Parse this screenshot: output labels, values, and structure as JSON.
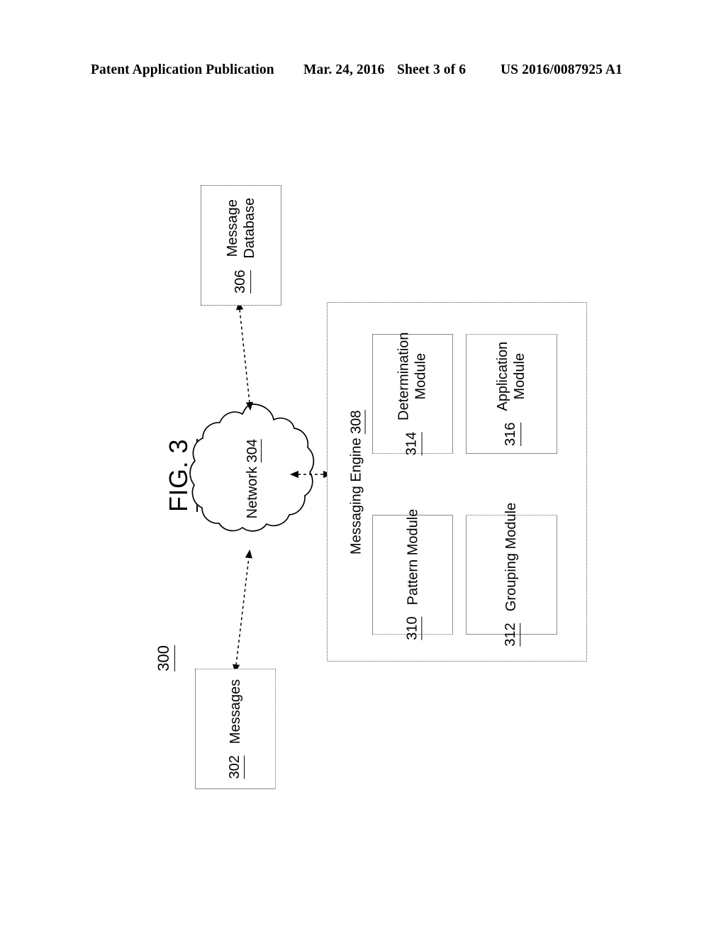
{
  "header": {
    "publication": "Patent Application Publication",
    "date": "Mar. 24, 2016",
    "sheet": "Sheet 3 of 6",
    "patent_number": "US 2016/0087925 A1"
  },
  "figure": {
    "title": "FIG. 3",
    "reference_numeral": "300"
  },
  "nodes": {
    "message_database": {
      "label_line1": "Message",
      "label_line2": "Database",
      "ref": "306"
    },
    "messages": {
      "label_line1": "Messages",
      "label_line2": "",
      "ref": "302"
    },
    "network": {
      "label_line1": "Network",
      "label_line2": "",
      "ref": "304"
    },
    "messaging_engine": {
      "label": "Messaging Engine",
      "ref": "308"
    },
    "pattern_module": {
      "label_line1": "Pattern Module",
      "label_line2": "",
      "ref": "310"
    },
    "grouping_module": {
      "label_line1": "Grouping Module",
      "label_line2": "",
      "ref": "312"
    },
    "determination_module": {
      "label_line1": "Determination",
      "label_line2": "Module",
      "ref": "314"
    },
    "application_module": {
      "label_line1": "Application",
      "label_line2": "Module",
      "ref": "316"
    }
  },
  "connectors": [
    {
      "from": "messages",
      "to": "network",
      "style": "dashed",
      "arrows": "both"
    },
    {
      "from": "network",
      "to": "message_database",
      "style": "dashed",
      "arrows": "both"
    },
    {
      "from": "network",
      "to": "messaging_engine",
      "style": "dashed",
      "arrows": "both"
    }
  ],
  "colors": {
    "ink": "#000000",
    "box_border": "#8a8a8a",
    "dotted_border": "#555555",
    "background": "#ffffff"
  }
}
